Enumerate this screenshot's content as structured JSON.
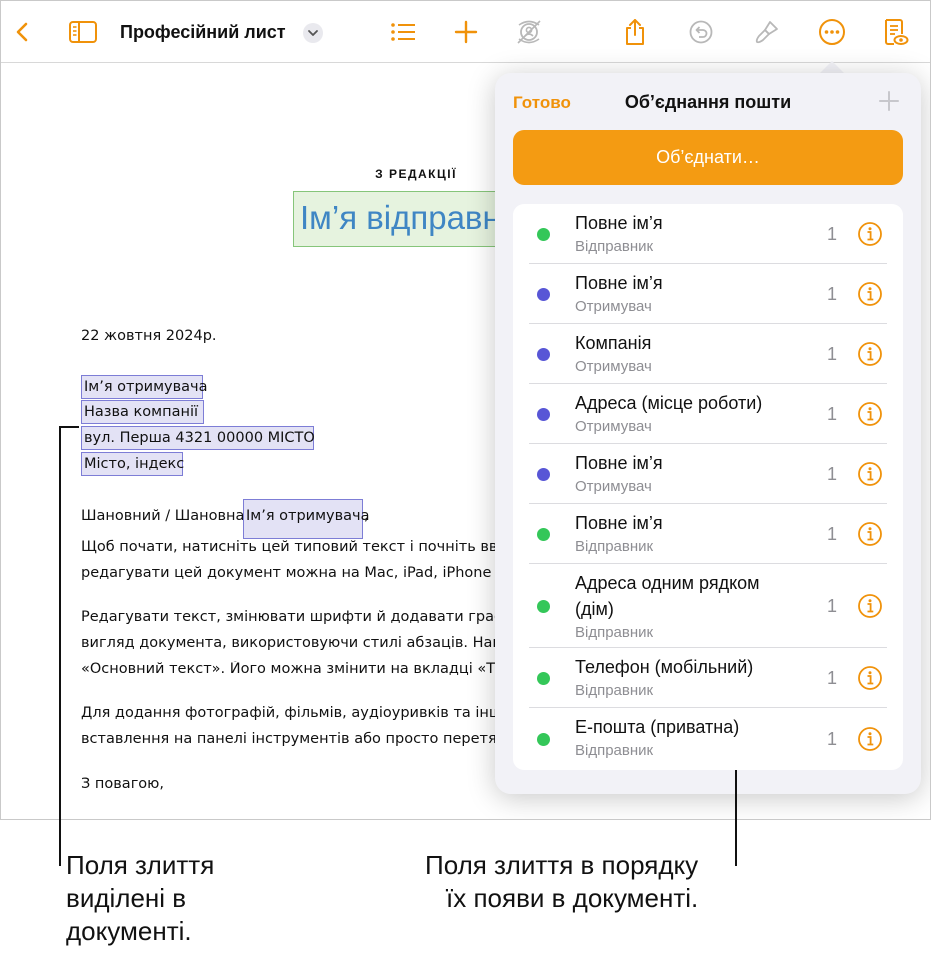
{
  "toolbar": {
    "doc_title": "Професійний лист",
    "accent": "#f0920a"
  },
  "document": {
    "eyebrow": "З РЕДАКЦІЇ",
    "sender_field": "Ім’я відправника",
    "date": "22 жовтня 2024р.",
    "recipient_name": "Ім’я отримувача",
    "company": "Назва компанії",
    "address": "вул. Перша 4321 00000 МІСТО",
    "city": "Місто, індекс",
    "greeting_prefix": "Шановний / Шановна",
    "greeting_field": "Ім’я отримувача",
    "greeting_suffix": ",",
    "paragraphs": [
      [
        "Щоб почати, натисніть цей типовий текст і почніть вводи",
        "редагувати цей документ можна на Mac, iPad, iPhone ч"
      ],
      [
        "Редагувати текст, змінювати шрифти й додавати графіку",
        "вигляд документа, використовуючи стилі абзаців. Напри",
        "«Основний текст». Його можна змінити на вкладці «Текс"
      ],
      [
        "Для додання фотографій, фільмів, аудіоуривків та інших",
        "вставлення на панелі інструментів або просто перетягуй"
      ]
    ],
    "closing": "З повагою,"
  },
  "popover": {
    "done_label": "Готово",
    "title": "Об’єднання пошти",
    "merge_label": "Об’єднати…",
    "fields": [
      {
        "title": "Повне ім’я",
        "subtitle": "Відправник",
        "count": "1",
        "color": "#34c759"
      },
      {
        "title": "Повне ім’я",
        "subtitle": "Отримувач",
        "count": "1",
        "color": "#5856d6"
      },
      {
        "title": "Компанія",
        "subtitle": "Отримувач",
        "count": "1",
        "color": "#5856d6"
      },
      {
        "title": "Адреса (місце роботи)",
        "subtitle": "Отримувач",
        "count": "1",
        "color": "#5856d6"
      },
      {
        "title": "Повне ім’я",
        "subtitle": "Отримувач",
        "count": "1",
        "color": "#5856d6"
      },
      {
        "title": "Повне ім’я",
        "subtitle": "Відправник",
        "count": "1",
        "color": "#34c759"
      },
      {
        "title": "Адреса одним рядком\n(дім)",
        "subtitle": "Відправник",
        "count": "1",
        "color": "#34c759"
      },
      {
        "title": "Телефон (мобільний)",
        "subtitle": "Відправник",
        "count": "1",
        "color": "#34c759"
      },
      {
        "title": "Е-пошта (приватна)",
        "subtitle": "Відправник",
        "count": "1",
        "color": "#34c759"
      }
    ]
  },
  "callouts": {
    "left": [
      "Поля злиття",
      "виділені в",
      "документі."
    ],
    "right": [
      "Поля злиття в порядку",
      "їх появи в документі."
    ]
  }
}
